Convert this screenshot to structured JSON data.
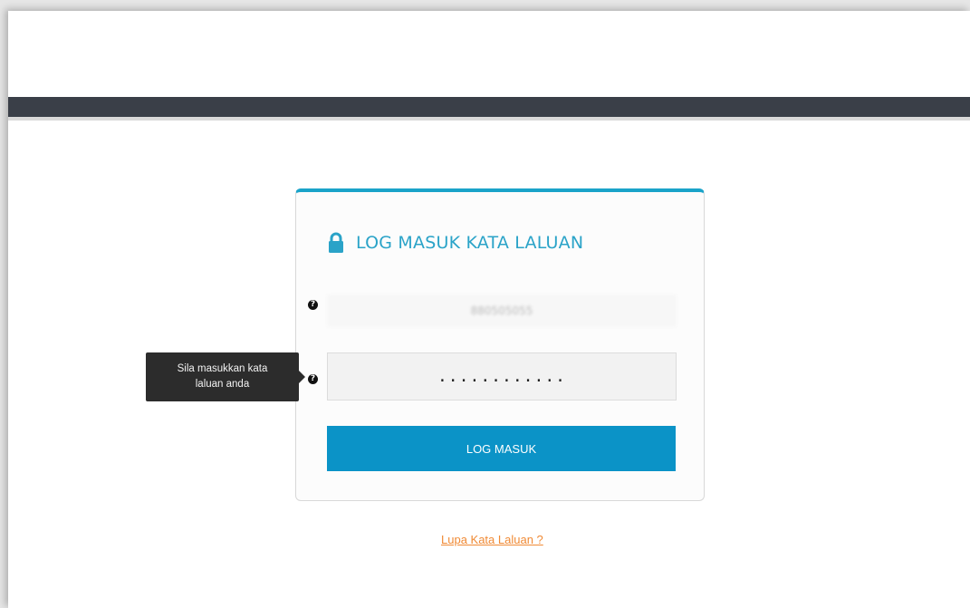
{
  "login": {
    "title": "LOG MASUK KATA LALUAN",
    "user_id": "880505055",
    "password": "............",
    "submit_label": "LOG MASUK",
    "forgot_label": "Lupa Kata Laluan ?"
  },
  "tooltip": {
    "line1": "Sila masukkan kata",
    "line2": "laluan anda"
  },
  "icons": {
    "lock": "lock-icon",
    "help": "question-circle-icon"
  },
  "colors": {
    "accent": "#2aa3c8",
    "button": "#0b93c7",
    "topbar": "#3a3f48",
    "link": "#f08a35"
  }
}
